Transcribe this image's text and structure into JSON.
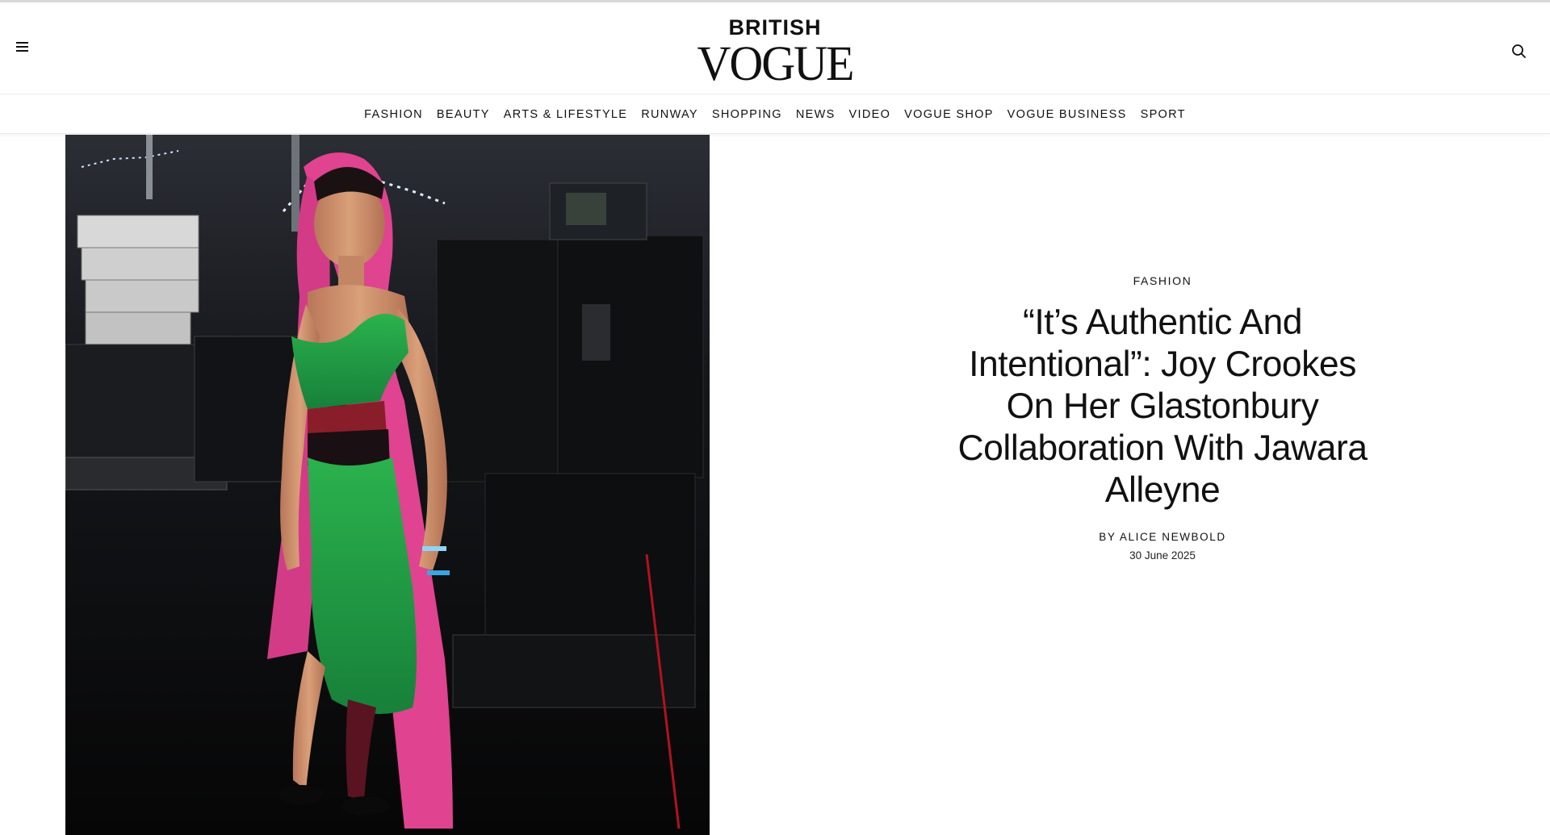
{
  "header": {
    "logo_top": "BRITISH",
    "logo_main": "VOGUE",
    "menu_icon": "hamburger-menu-icon",
    "search_icon": "search-icon"
  },
  "nav": {
    "items": [
      "FASHION",
      "BEAUTY",
      "ARTS & LIFESTYLE",
      "RUNWAY",
      "SHOPPING",
      "NEWS",
      "VIDEO",
      "VOGUE SHOP",
      "VOGUE BUSINESS",
      "SPORT"
    ]
  },
  "article": {
    "category": "FASHION",
    "headline": "“It’s Authentic And Intentional”: Joy Crookes On Her Glastonbury Collaboration With Jawara Alleyne",
    "byline_prefix": "BY",
    "author": "ALICE NEWBOLD",
    "date": "30 June 2025"
  },
  "colors": {
    "text": "#111111",
    "background": "#ffffff",
    "dress_green": "#1e9a3f",
    "hood_pink": "#e0438f"
  }
}
